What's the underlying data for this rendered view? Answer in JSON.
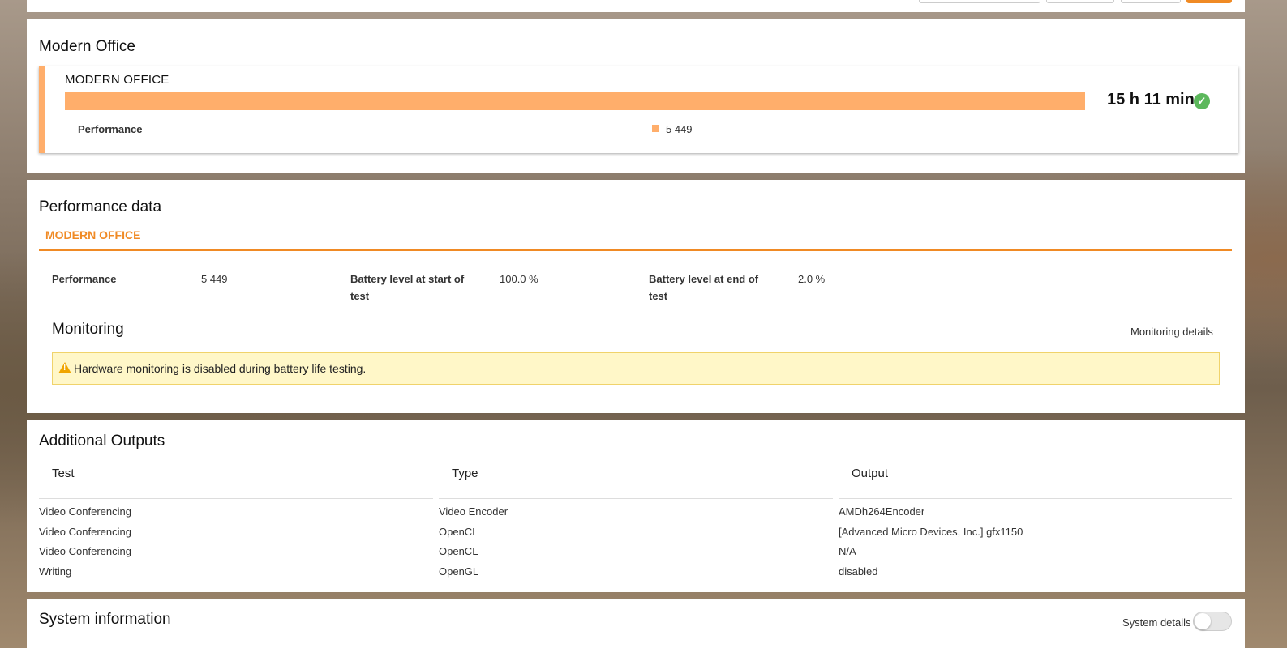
{
  "modern_office_section": {
    "title": "Modern Office",
    "card_title": "MODERN OFFICE",
    "score": "15 h 11 min",
    "sub_label": "Performance",
    "sub_value": "5 449",
    "bar_fill": 1.0
  },
  "performance_data": {
    "title": "Performance data",
    "tab": "MODERN OFFICE",
    "items": [
      {
        "label": "Performance",
        "value": "5 449"
      },
      {
        "label": "Battery level at start of test",
        "value": "100.0 %"
      },
      {
        "label": "Battery level at end of test",
        "value": "2.0 %"
      }
    ],
    "monitoring_title": "Monitoring",
    "monitoring_link": "Monitoring details",
    "warning": "Hardware monitoring is disabled during battery life testing."
  },
  "additional_outputs": {
    "title": "Additional Outputs",
    "columns": [
      "Test",
      "Type",
      "Output"
    ],
    "rows": [
      [
        "Video Conferencing",
        "Video Encoder",
        "AMDh264Encoder"
      ],
      [
        "Video Conferencing",
        "OpenCL",
        "[Advanced Micro Devices, Inc.] gfx1150"
      ],
      [
        "Video Conferencing",
        "OpenCL",
        "N/A"
      ],
      [
        "Writing",
        "OpenGL",
        "disabled"
      ]
    ]
  },
  "system_information": {
    "title": "System information",
    "toggle_label": "System details",
    "toggle_on": false
  },
  "colors": {
    "accent": "#f08a24",
    "bar": "#ffae6b",
    "check": "#5cb85c",
    "warning_bg": "#fff7c8"
  }
}
